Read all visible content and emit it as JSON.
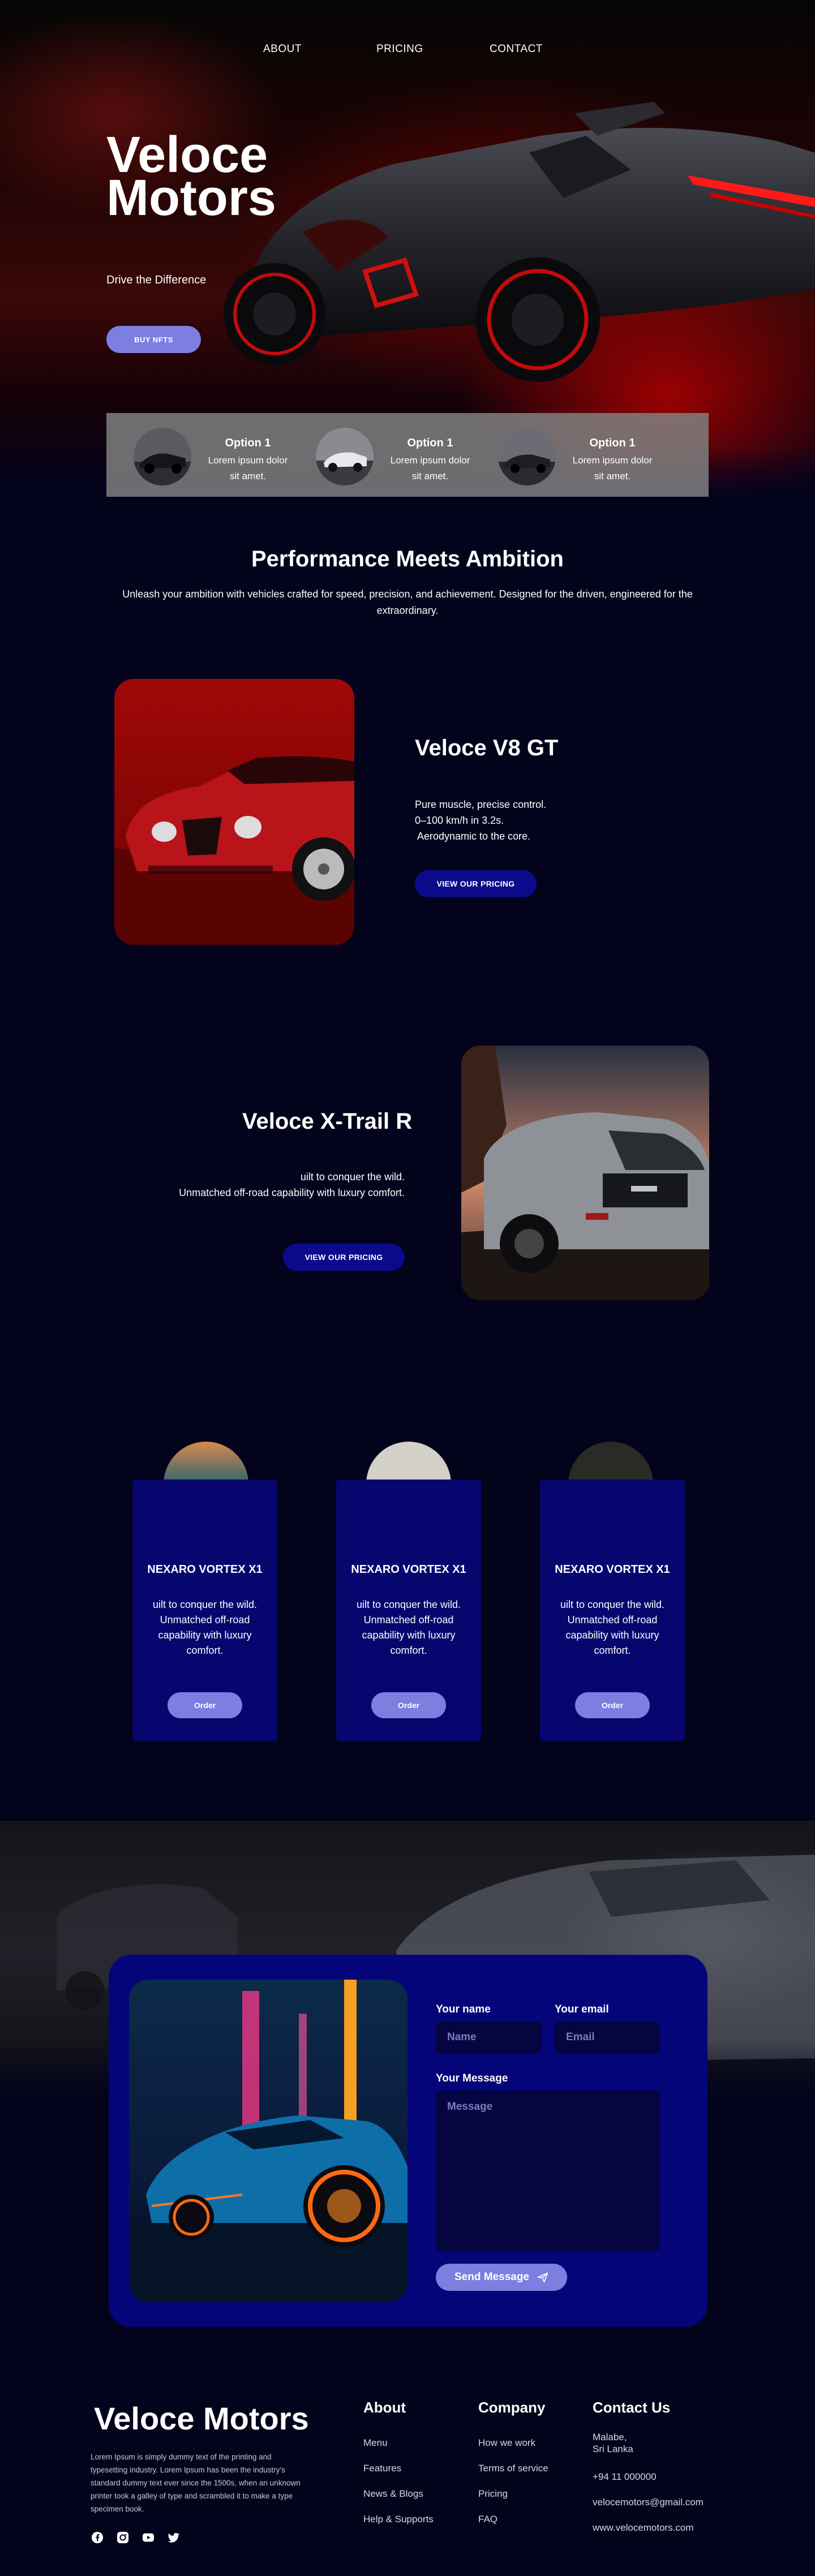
{
  "nav": {
    "items": [
      "ABOUT",
      "PRICING",
      "CONTACT"
    ]
  },
  "hero": {
    "title": "Veloce Motors",
    "tagline": "Drive the Difference",
    "cta": "BUY NFTS"
  },
  "options": [
    {
      "title": "Option 1",
      "desc": "Lorem ipsum dolor sit amet."
    },
    {
      "title": "Option 1",
      "desc": "Lorem ipsum dolor sit amet."
    },
    {
      "title": "Option 1",
      "desc": "Lorem ipsum dolor sit amet."
    }
  ],
  "performance": {
    "title": "Performance Meets Ambition",
    "subtitle": "Unleash your ambition with vehicles crafted for speed, precision, and achievement. Designed for the driven, engineered for the extraordinary."
  },
  "features": [
    {
      "title": "Veloce V8 GT",
      "lines": [
        "Pure muscle, precise control.",
        "0–100 km/h in 3.2s.",
        " Aerodynamic to the core."
      ],
      "cta": "VIEW OUR PRICING"
    },
    {
      "title": "Veloce X-Trail R",
      "lines": [
        "uilt to conquer the wild.",
        "Unmatched off-road capability with luxury comfort."
      ],
      "cta": "VIEW OUR PRICING"
    }
  ],
  "cards": [
    {
      "title": "NEXARO VORTEX X1",
      "desc": "uilt to conquer the wild. Unmatched off-road capability with luxury comfort.",
      "cta": "Order"
    },
    {
      "title": "NEXARO VORTEX X1",
      "desc": "uilt to conquer the wild. Unmatched off-road capability with luxury comfort.",
      "cta": "Order"
    },
    {
      "title": "NEXARO VORTEX X1",
      "desc": "uilt to conquer the wild. Unmatched off-road capability with luxury comfort.",
      "cta": "Order"
    }
  ],
  "contact": {
    "name_label": "Your name",
    "name_placeholder": "Name",
    "email_label": "Your email",
    "email_placeholder": "Email",
    "message_label": "Your Message",
    "message_placeholder": "Message",
    "send": "Send Message"
  },
  "footer": {
    "brand": "Veloce Motors",
    "lorem": "Lorem Ipsum is simply dummy text of the printing and typesetting industry. Lorem Ipsum has been the industry's standard dummy text ever since the 1500s, when an unknown printer took a galley of type and scrambled it to make a type specimen book.",
    "about": {
      "heading": "About",
      "links": [
        "Menu",
        "Features",
        "News & Blogs",
        "Help & Supports"
      ]
    },
    "company": {
      "heading": "Company",
      "links": [
        "How we work",
        "Terms of service",
        "Pricing",
        "FAQ"
      ]
    },
    "contact": {
      "heading": "Contact Us",
      "address_line1": "Malabe,",
      "address_line2": "Sri Lanka",
      "phone": "+94 11 000000",
      "email": "velocemotors@gmail.com",
      "website": "www.velocemotors.com"
    },
    "social_icons": [
      "facebook-icon",
      "instagram-icon",
      "youtube-icon",
      "twitter-icon"
    ]
  }
}
